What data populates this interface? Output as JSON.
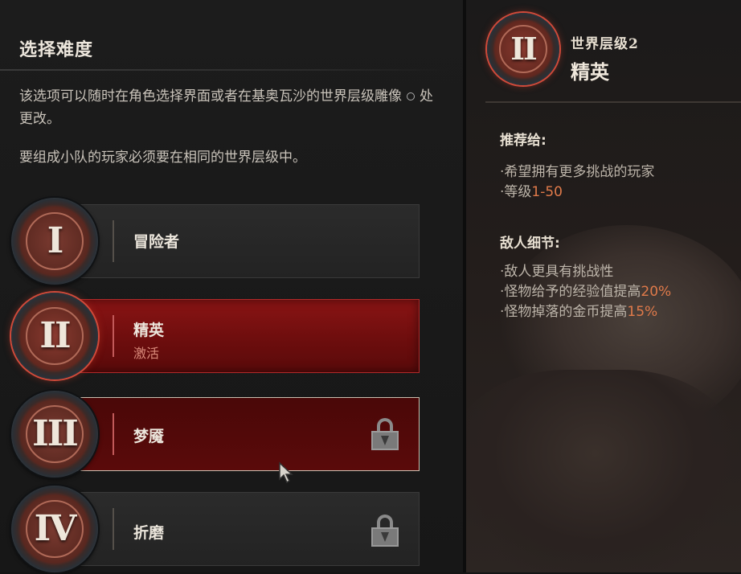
{
  "left": {
    "title": "选择难度",
    "desc1_a": "该选项可以随时在角色选择界面或者在基奥瓦沙的世界层级雕像",
    "desc1_b": "处更改。",
    "desc2": "要组成小队的玩家必须要在相同的世界层级中。",
    "tiers": [
      {
        "numeral": "I",
        "label": "冒险者",
        "sub": "",
        "state": "normal",
        "locked": false
      },
      {
        "numeral": "II",
        "label": "精英",
        "sub": "激活",
        "state": "active",
        "locked": false
      },
      {
        "numeral": "III",
        "label": "梦魇",
        "sub": "",
        "state": "hover",
        "locked": true
      },
      {
        "numeral": "IV",
        "label": "折磨",
        "sub": "",
        "state": "normal",
        "locked": true
      }
    ]
  },
  "right": {
    "numeral": "II",
    "world_tier": "世界层级2",
    "tier_name": "精英",
    "recommend_title": "推荐给:",
    "recommend": [
      {
        "prefix": "·希望拥有更多挑战的玩家",
        "hl": ""
      },
      {
        "prefix": "·等级",
        "hl": "1-50"
      }
    ],
    "enemy_title": "敌人细节:",
    "enemy": [
      {
        "prefix": "·敌人更具有挑战性",
        "hl": ""
      },
      {
        "prefix": "·怪物给予的经验值提高",
        "hl": "20%"
      },
      {
        "prefix": "·怪物掉落的金币提高",
        "hl": "15%"
      }
    ]
  },
  "colors": {
    "active_red": "#8a1414",
    "highlight": "#e07a4a"
  },
  "icons": [
    "gem-icon",
    "lock-icon",
    "cursor-icon",
    "tier-emblem-icon"
  ]
}
